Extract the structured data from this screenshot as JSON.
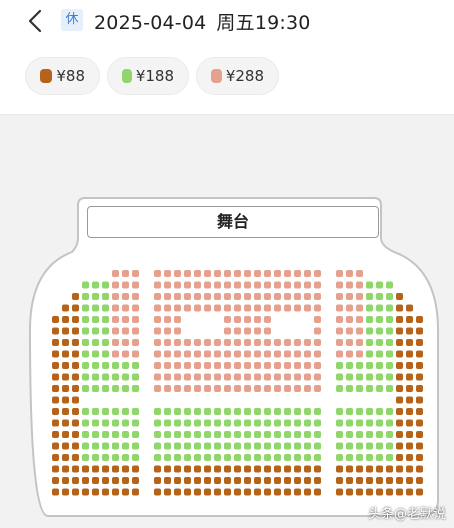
{
  "header": {
    "holiday_badge": "休",
    "date": "2025-04-04",
    "weekday_time": "周五19:30"
  },
  "prices": [
    {
      "label": "¥88",
      "color": "#b5631a"
    },
    {
      "label": "¥188",
      "color": "#8fd66b"
    },
    {
      "label": "¥288",
      "color": "#e6a18e"
    }
  ],
  "stage": {
    "label": "舞台"
  },
  "seat_colors": {
    "tier88": "#b5631a",
    "tier188": "#8fd66b",
    "tier288": "#e6a18e"
  },
  "watermark": "头条@老默说"
}
